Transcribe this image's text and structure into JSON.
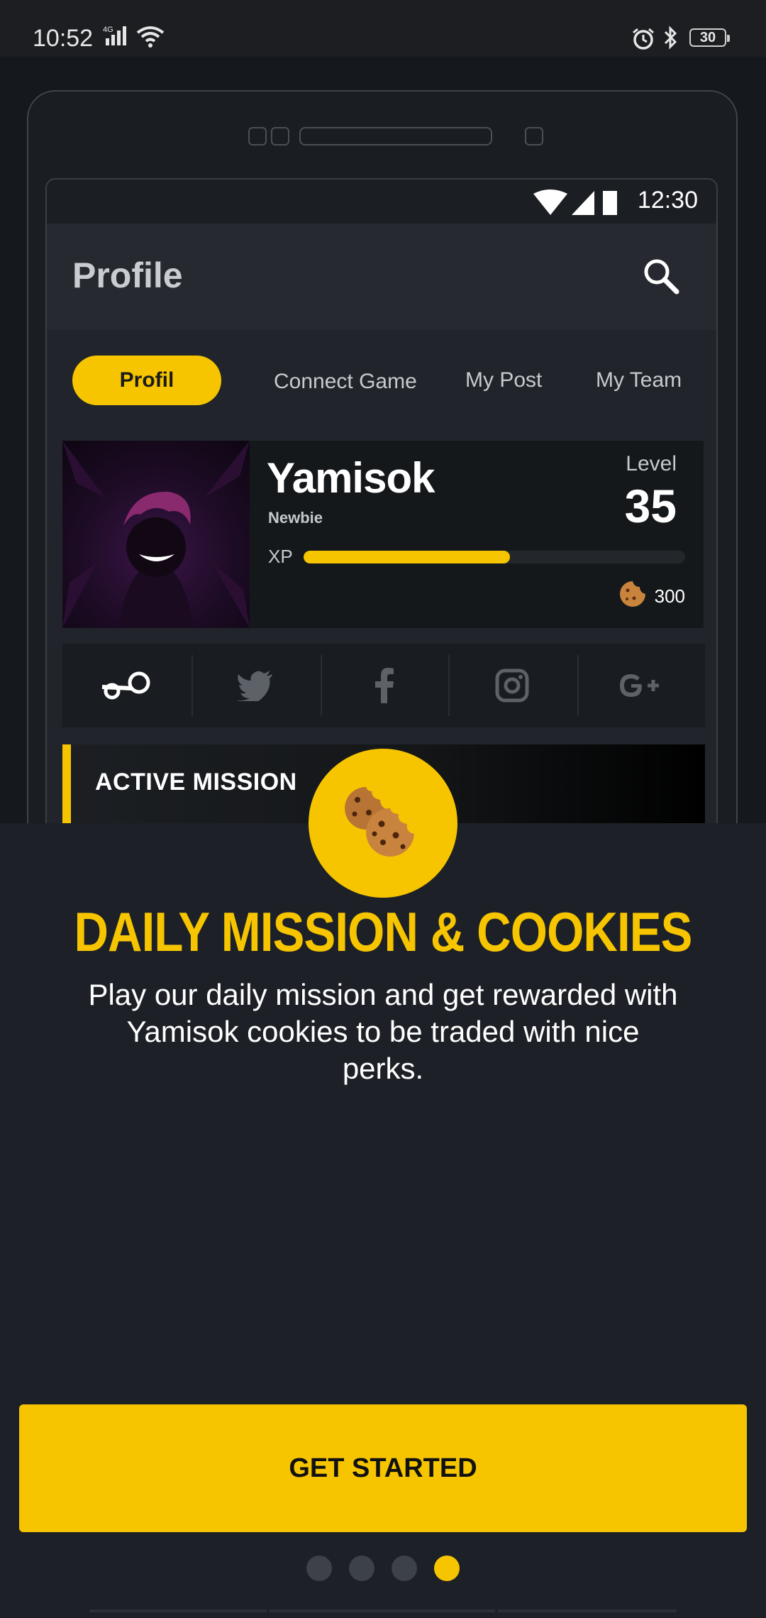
{
  "status_bar": {
    "time": "10:52",
    "network": "4G",
    "battery": "30"
  },
  "mock_app": {
    "screen_time": "12:30",
    "title": "Profile",
    "tabs": [
      {
        "label": "Profil",
        "active": true
      },
      {
        "label": "Connect Game",
        "active": false
      },
      {
        "label": "My Post",
        "active": false
      },
      {
        "label": "My Team",
        "active": false
      }
    ],
    "user": {
      "name": "Yamisok",
      "rank": "Newbie",
      "xp_label": "XP",
      "xp_progress": 0.54,
      "level_label": "Level",
      "level": "35",
      "cookies": "300"
    },
    "social_icons": [
      "steam-icon",
      "twitter-icon",
      "facebook-icon",
      "instagram-icon",
      "google-plus-icon"
    ],
    "mission_title": "ACTIVE MISSION"
  },
  "onboarding": {
    "heading": "DAILY MISSION & COOKIES",
    "description": "Play our daily mission and get rewarded with Yamisok cookies to be traded with nice perks.",
    "cta_label": "GET STARTED",
    "page_count": 4,
    "current_page": 4
  },
  "colors": {
    "accent": "#f6c500",
    "background": "#1d2127"
  }
}
